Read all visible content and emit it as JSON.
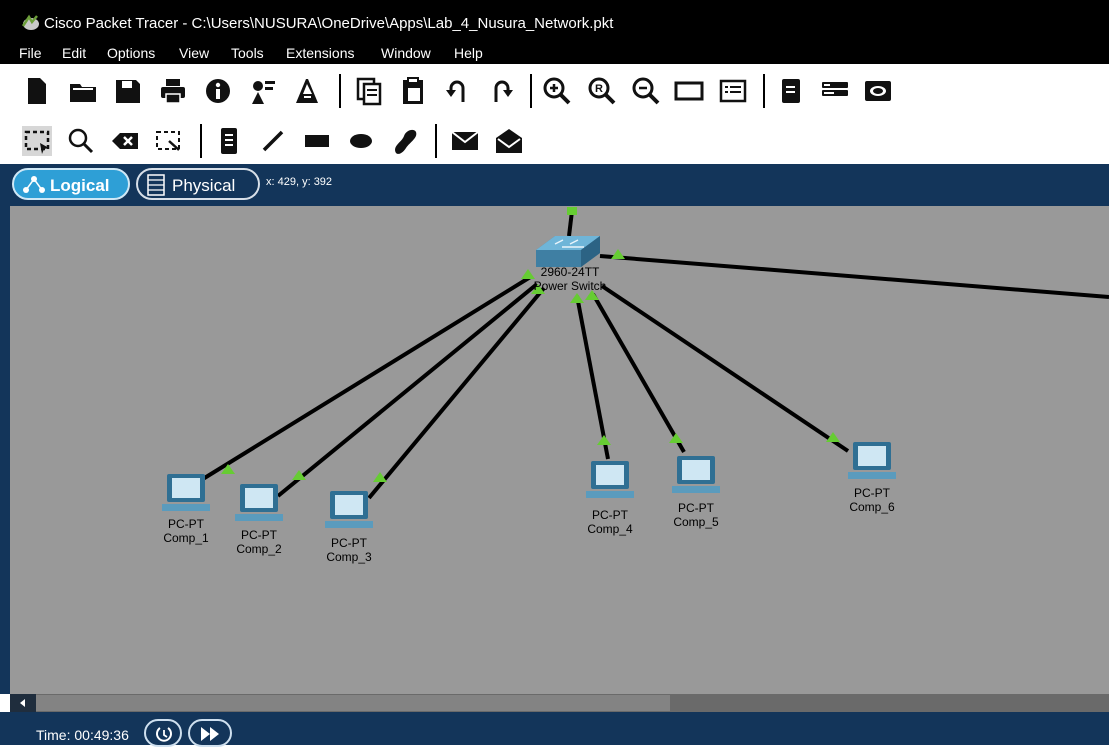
{
  "window": {
    "title": "Cisco Packet Tracer - C:\\Users\\NUSURA\\OneDrive\\Apps\\Lab_4_Nusura_Network.pkt"
  },
  "menu": [
    "File",
    "Edit",
    "Options",
    "View",
    "Tools",
    "Extensions",
    "Window",
    "Help"
  ],
  "toolbar_main": [
    "new-file-icon",
    "open-folder-icon",
    "save-icon",
    "print-icon",
    "info-icon",
    "activity-wizard-icon",
    "pdu-icon",
    "copy-icon",
    "paste-icon",
    "undo-icon",
    "redo-icon",
    "zoom-in-icon",
    "zoom-reset-icon",
    "zoom-out-icon",
    "drawing-palette-icon",
    "custom-devices-icon",
    "document-icon",
    "network-device-icon",
    "cluster-icon"
  ],
  "toolbar_tools": [
    "select-icon",
    "inspect-icon",
    "delete-icon",
    "resize-shape-icon",
    "place-note-icon",
    "draw-line-icon",
    "draw-rectangle-icon",
    "draw-ellipse-icon",
    "freeform-icon",
    "add-simple-pdu-icon",
    "add-complex-pdu-icon"
  ],
  "mode": {
    "logical": "Logical",
    "physical": "Physical",
    "coords": "x: 429, y: 392"
  },
  "topology": {
    "switch": {
      "model": "2960-24TT",
      "name": "Power Switch"
    },
    "pcs": [
      {
        "model": "PC-PT",
        "name": "Comp_1"
      },
      {
        "model": "PC-PT",
        "name": "Comp_2"
      },
      {
        "model": "PC-PT",
        "name": "Comp_3"
      },
      {
        "model": "PC-PT",
        "name": "Comp_4"
      },
      {
        "model": "PC-PT",
        "name": "Comp_5"
      },
      {
        "model": "PC-PT",
        "name": "Comp_6"
      }
    ]
  },
  "status": {
    "time": "Time: 00:49:36"
  },
  "colors": {
    "title_bar": "#000000",
    "mode_bar": "#13355a",
    "logical_tab": "#2e9fd6",
    "workspace": "#999999",
    "link_up": "#66cc33"
  }
}
